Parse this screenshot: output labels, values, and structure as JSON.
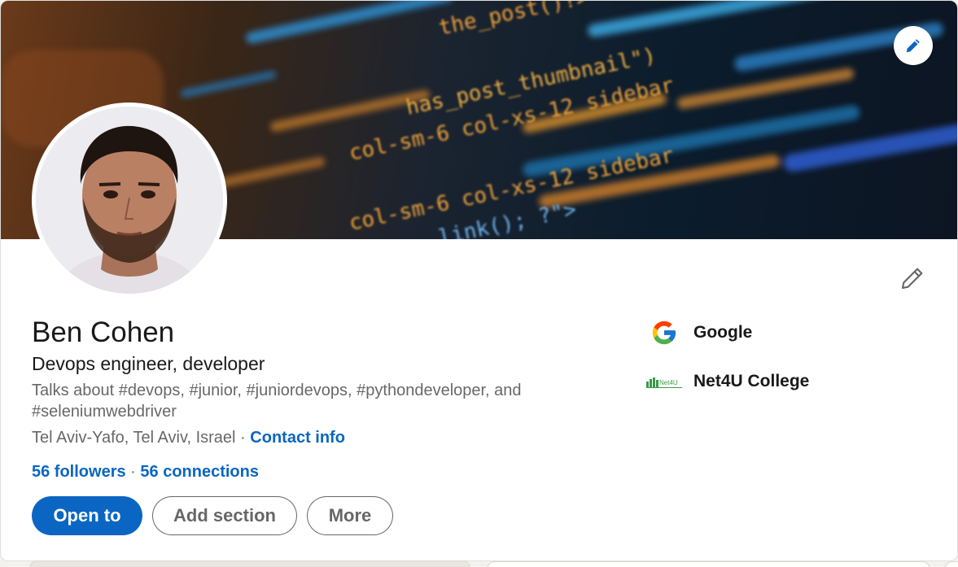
{
  "profile": {
    "name": "Ben Cohen",
    "headline": "Devops engineer, developer",
    "talks_about": "Talks about #devops, #junior, #juniordevops, #pythondeveloper, and #seleniumwebdriver",
    "location": "Tel Aviv-Yafo, Tel Aviv, Israel",
    "location_separator": " · ",
    "contact_info": "Contact info",
    "followers": "56 followers",
    "connections_separator": " · ",
    "connections": "56 connections"
  },
  "banner": {
    "code_lines": [
      "the_post()?>",
      "has_post_thumbnail\")",
      "col-sm-6 col-xs-12 sidebar",
      "col-sm-6 col-xs-12 sidebar",
      "link(); ?\">"
    ]
  },
  "actions": {
    "open_to": "Open to",
    "add_section": "Add section",
    "more": "More"
  },
  "organizations": [
    {
      "name": "Google",
      "logo": "google-logo"
    },
    {
      "name": "Net4U College",
      "logo": "net4u-logo",
      "logo_text": "Net4U"
    }
  ],
  "icons": {
    "banner_edit": "pencil-icon",
    "intro_edit": "pencil-icon"
  },
  "colors": {
    "brand_blue": "#0a66c2",
    "text_primary": "#191919",
    "text_secondary": "#666666",
    "card_background": "#ffffff",
    "page_background": "#f3f2ef"
  }
}
